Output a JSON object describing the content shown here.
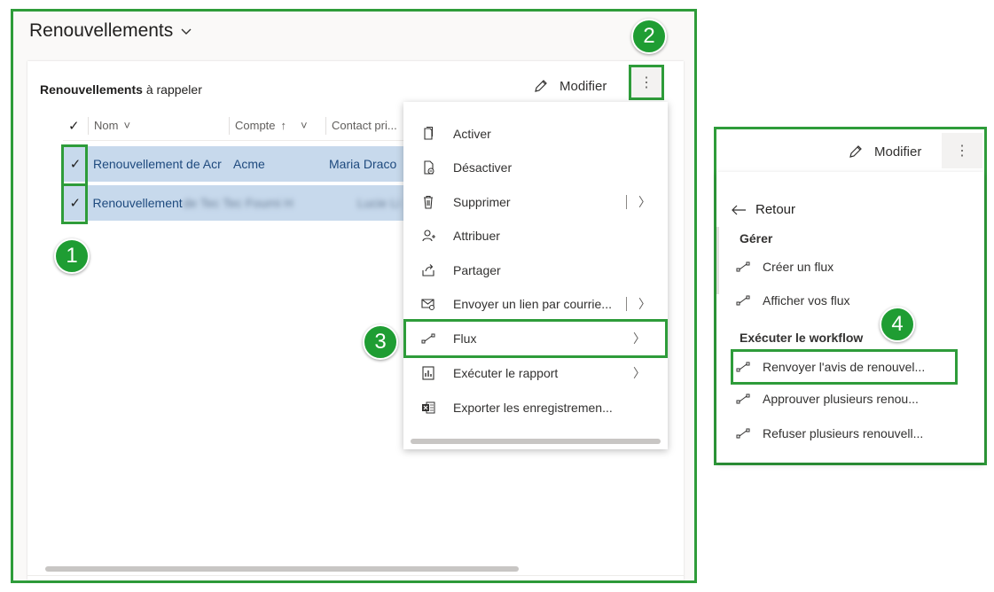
{
  "dashboard": {
    "title": "Renouvellements"
  },
  "card": {
    "title": "Renouvellements",
    "title_suffix": "à rappeler",
    "modify_label": "Modifier",
    "more_glyph": "⋮"
  },
  "grid": {
    "check_glyph": "✓",
    "columns": [
      {
        "label": "Nom",
        "sort": "˅"
      },
      {
        "label": "Compte",
        "sort": "↑"
      },
      {
        "label": "Contact pri..."
      }
    ],
    "rows": [
      {
        "name": "Renouvellement de Acr",
        "account": "Acme",
        "contact": "Maria Draco"
      },
      {
        "name": "Renouvellement",
        "account": "de Tec Tec Fourni H",
        "contact": "Lucie Li"
      }
    ]
  },
  "menu": {
    "items": [
      {
        "label": "Activer",
        "icon": "document-icon"
      },
      {
        "label": "Désactiver",
        "icon": "deactivate-icon"
      },
      {
        "label": "Supprimer",
        "icon": "trash-icon",
        "chevron": "〉"
      },
      {
        "label": "Attribuer",
        "icon": "person-icon"
      },
      {
        "label": "Partager",
        "icon": "share-icon"
      },
      {
        "label": "Envoyer un lien par courrie...",
        "icon": "mail-link-icon",
        "chevron": "〉"
      },
      {
        "label": "Flux",
        "icon": "flow-icon",
        "chevron": "〉"
      },
      {
        "label": "Exécuter le rapport",
        "icon": "report-icon",
        "chevron": "〉"
      },
      {
        "label": "Exporter les enregistremen...",
        "icon": "excel-icon"
      }
    ]
  },
  "flow_panel": {
    "modify_label": "Modifier",
    "more_glyph": "⋮",
    "back_label": "Retour",
    "manage_heading": "Gérer",
    "manage_items": [
      "Créer un flux",
      "Afficher vos flux"
    ],
    "workflow_heading": "Exécuter le workflow",
    "workflow_items": [
      "Renvoyer l'avis de renouvel...",
      "Approuver plusieurs renou...",
      "Refuser plusieurs renouvell..."
    ]
  },
  "badges": [
    "1",
    "2",
    "3",
    "4"
  ],
  "colors": {
    "highlight_green": "#2e9c3a",
    "badge_green": "#1f9d33",
    "selected_row": "#c7d9ec"
  }
}
